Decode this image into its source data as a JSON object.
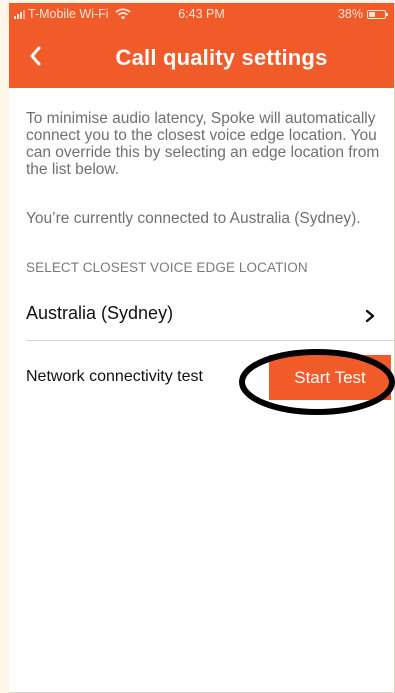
{
  "status_bar": {
    "carrier": "T-Mobile Wi-Fi",
    "time": "6:43 PM",
    "battery_percent": "38%",
    "battery_level": 0.38,
    "icons": [
      "signal-icon",
      "wifi-icon",
      "battery-icon"
    ]
  },
  "nav": {
    "title": "Call quality settings",
    "back_icon": "chevron-left-icon"
  },
  "content": {
    "intro": "To minimise audio latency, Spoke will automatically connect you to the closest voice edge location. You can override this by selecting an edge location from the list below.",
    "connected": "You’re currently connected to Australia (Sydney).",
    "section_header": "SELECT CLOSEST VOICE EDGE LOCATION",
    "location": {
      "label": "Australia (Sydney)",
      "icon": "chevron-right-icon"
    },
    "network_test": {
      "label": "Network connectivity test",
      "button_label": "Start Test"
    }
  },
  "colors": {
    "brand": "#f15a29",
    "text_primary": "#111111",
    "text_secondary": "#707070",
    "annotation": "#000000"
  }
}
